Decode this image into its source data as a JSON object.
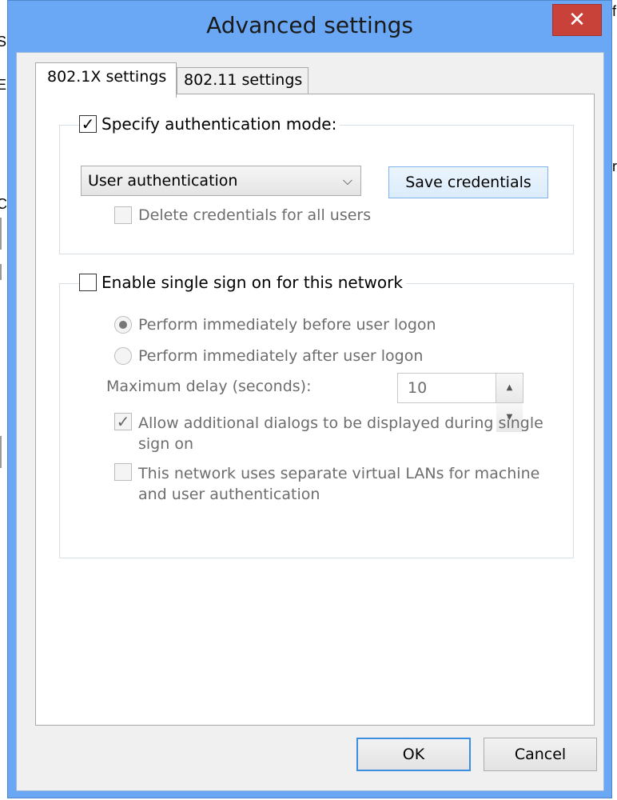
{
  "window": {
    "title": "Advanced settings",
    "close_glyph": "✕"
  },
  "tabs": [
    {
      "label": "802.1X settings",
      "active": true
    },
    {
      "label": "802.11 settings",
      "active": false
    }
  ],
  "auth_group": {
    "specify_mode_label": "Specify authentication mode:",
    "specify_mode_checked": true,
    "mode_selected": "User authentication",
    "save_credentials_label": "Save credentials",
    "delete_credentials_label": "Delete credentials for all users",
    "delete_credentials_checked": false
  },
  "sso_group": {
    "enable_label": "Enable single sign on for this network",
    "enable_checked": false,
    "before_logon_label": "Perform immediately before user logon",
    "before_logon_selected": true,
    "after_logon_label": "Perform immediately after user logon",
    "after_logon_selected": false,
    "max_delay_label": "Maximum delay (seconds):",
    "max_delay_value": "10",
    "allow_dialogs_label_line1": "Allow additional dialogs to be displayed during single",
    "allow_dialogs_label_line2": "sign on",
    "allow_dialogs_checked": true,
    "separate_vlans_label_line1": "This network uses separate virtual LANs for machine",
    "separate_vlans_label_line2": "and user authentication",
    "separate_vlans_checked": false
  },
  "footer": {
    "ok_label": "OK",
    "cancel_label": "Cancel"
  },
  "glyphs": {
    "check": "✓",
    "dropdown": "⌵",
    "spin_up": "▲",
    "spin_down": "▼"
  },
  "background_fragments": {
    "left": [
      "S",
      "E",
      "C"
    ],
    "right": [
      "f",
      "r"
    ]
  },
  "colors": {
    "titlebar": "#6aa8f5",
    "close_button": "#c9423a",
    "ok_border": "#3c8fe0"
  }
}
